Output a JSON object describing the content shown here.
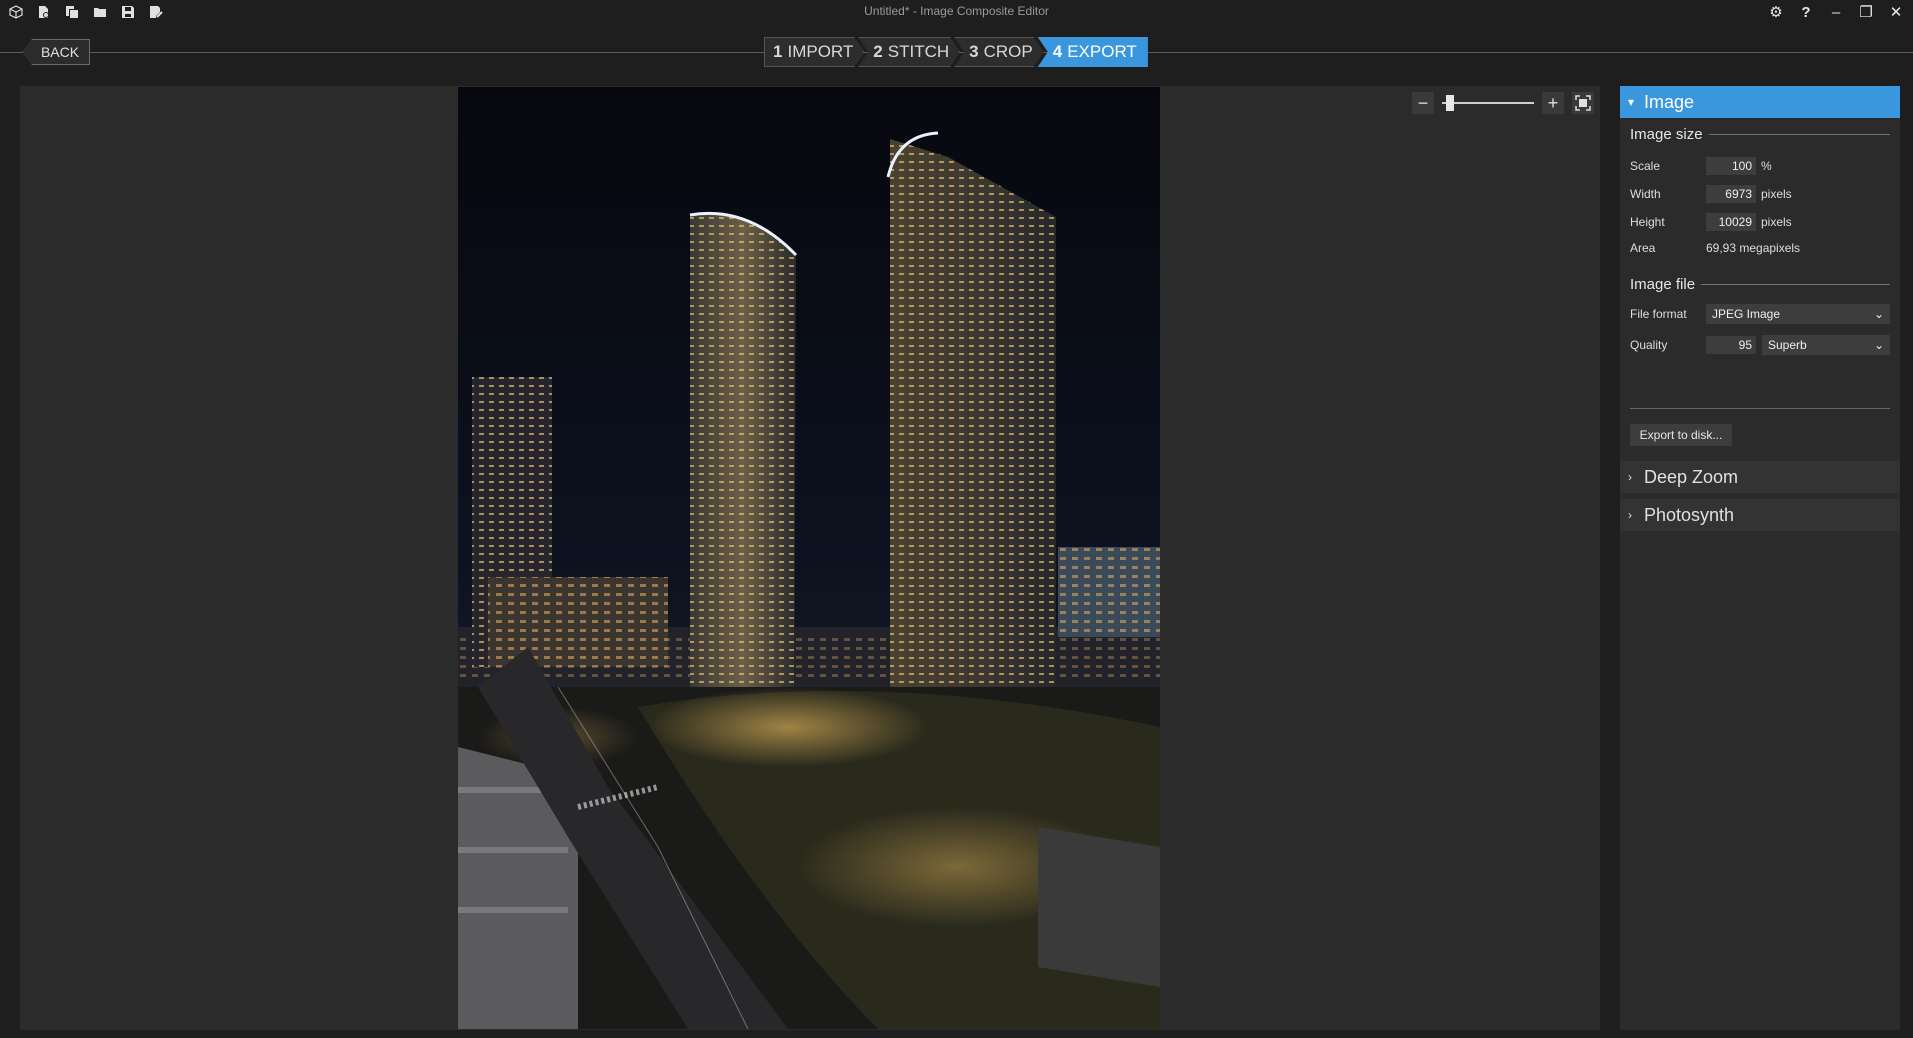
{
  "titlebar": {
    "title": "Untitled* - Image Composite Editor",
    "left_icons": [
      "new-panorama-icon",
      "new-from-video-icon",
      "open-image-set-icon",
      "open-folder-icon",
      "save-icon",
      "save-as-icon"
    ],
    "right_icons": [
      "settings-icon",
      "help-icon",
      "minimize-icon",
      "restore-icon",
      "close-icon"
    ],
    "settings_glyph": "⚙",
    "help_glyph": "?",
    "minimize_glyph": "–",
    "restore_glyph": "❐",
    "close_glyph": "✕"
  },
  "nav": {
    "back_label": "BACK",
    "steps": [
      {
        "num": "1",
        "label": "IMPORT",
        "active": false
      },
      {
        "num": "2",
        "label": "STITCH",
        "active": false
      },
      {
        "num": "3",
        "label": "CROP",
        "active": false
      },
      {
        "num": "4",
        "label": "EXPORT",
        "active": true
      }
    ]
  },
  "zoom": {
    "minus": "−",
    "plus": "+",
    "level": 0.05
  },
  "panel": {
    "image_section": "Image",
    "image_size_title": "Image size",
    "scale_label": "Scale",
    "scale_value": "100",
    "scale_unit": "%",
    "width_label": "Width",
    "width_value": "6973",
    "width_unit": "pixels",
    "height_label": "Height",
    "height_value": "10029",
    "height_unit": "pixels",
    "area_label": "Area",
    "area_value": "69,93 megapixels",
    "image_file_title": "Image file",
    "file_format_label": "File format",
    "file_format_value": "JPEG Image",
    "quality_label": "Quality",
    "quality_value": "95",
    "quality_preset": "Superb",
    "export_label": "Export to disk...",
    "deep_zoom_section": "Deep Zoom",
    "photosynth_section": "Photosynth"
  },
  "colors": {
    "accent": "#3a96dd",
    "background": "#1e1e1e",
    "panel": "#2b2b2b"
  }
}
